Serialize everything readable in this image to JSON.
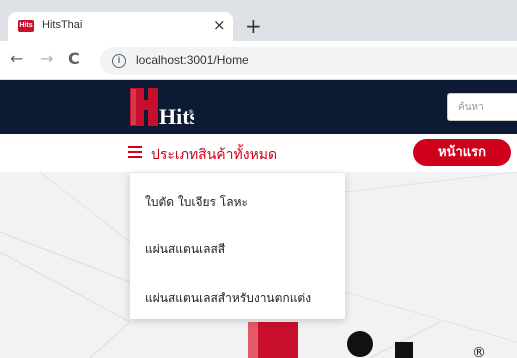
{
  "browser": {
    "tab_title": "HitsThai",
    "tab_close": "×",
    "new_tab": "+",
    "back": "←",
    "forward": "→",
    "reload": "C",
    "url": "localhost:3001/Home",
    "favicon_text": "Hits"
  },
  "header": {
    "search_placeholder": "ค้นหา",
    "logo_text": "Hits"
  },
  "nav": {
    "category_label": "ประเภทสินค้าทั้งหมด",
    "home_button": "หน้าแรก"
  },
  "dropdown": {
    "items": [
      "ใบตัด ใบเจียร โลหะ",
      "แผ่นสแตนเลสสี",
      "แผ่นสแตนเลสสำหรับงานตกแต่ง"
    ]
  },
  "hero": {
    "registered_mark": "®"
  },
  "colors": {
    "brand_red": "#d0021b",
    "header_navy": "#0c1b33"
  }
}
